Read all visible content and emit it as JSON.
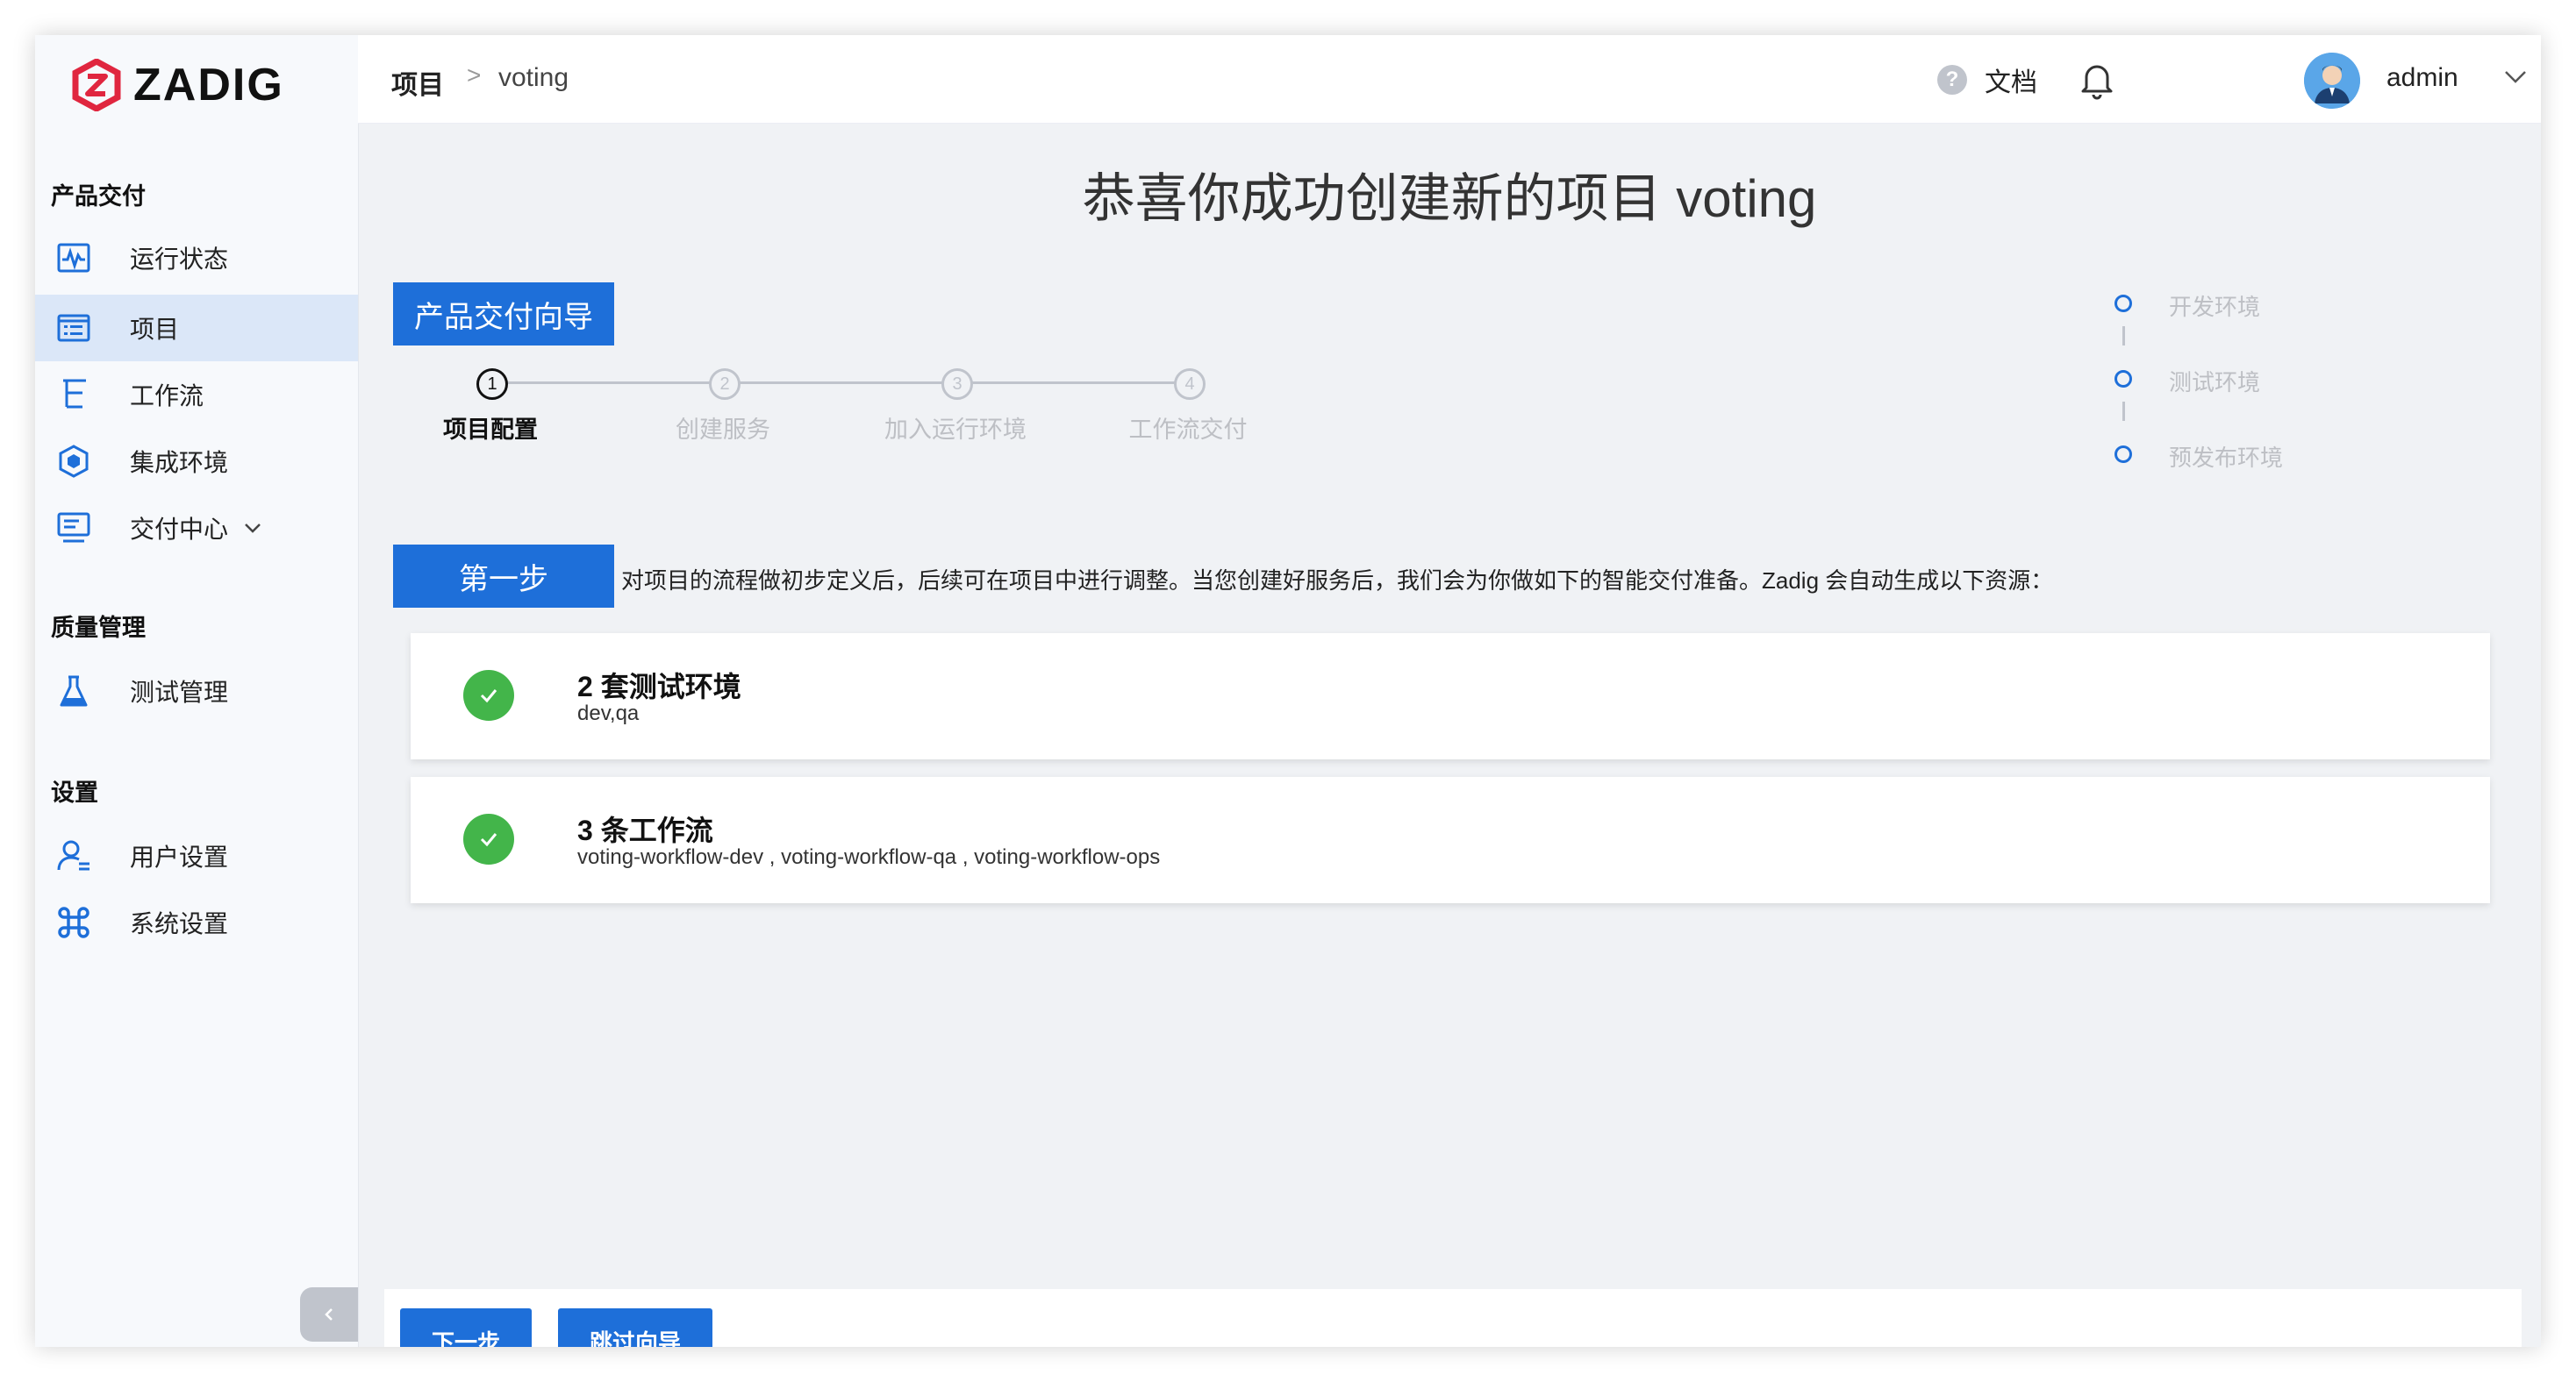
{
  "app": {
    "logo_text": "ZADIG",
    "brand_color": "#e0263f",
    "accent_color": "#1e6fd9",
    "success_color": "#43b54a"
  },
  "sidebar": {
    "sections": [
      {
        "title": "产品交付",
        "items": [
          {
            "label": "运行状态",
            "icon": "pulse-monitor-icon"
          },
          {
            "label": "项目",
            "icon": "project-list-icon",
            "active": true
          },
          {
            "label": "工作流",
            "icon": "workflow-tree-icon"
          },
          {
            "label": "集成环境",
            "icon": "cube-cluster-icon"
          },
          {
            "label": "交付中心",
            "icon": "delivery-screen-icon",
            "expandable": true
          }
        ]
      },
      {
        "title": "质量管理",
        "items": [
          {
            "label": "测试管理",
            "icon": "flask-icon"
          }
        ]
      },
      {
        "title": "设置",
        "items": [
          {
            "label": "用户设置",
            "icon": "user-settings-icon"
          },
          {
            "label": "系统设置",
            "icon": "command-icon"
          }
        ]
      }
    ],
    "collapse_glyph": "‹"
  },
  "header": {
    "breadcrumb_root": "项目",
    "breadcrumb_sep": ">",
    "breadcrumb_current": "voting",
    "help_glyph": "?",
    "doc_label": "文档",
    "username": "admin"
  },
  "main": {
    "title": "恭喜你成功创建新的项目 voting",
    "guide_tag": "产品交付向导",
    "steps": [
      {
        "num": "1",
        "label": "项目配置",
        "active": true
      },
      {
        "num": "2",
        "label": "创建服务",
        "active": false
      },
      {
        "num": "3",
        "label": "加入运行环境",
        "active": false
      },
      {
        "num": "4",
        "label": "工作流交付",
        "active": false
      }
    ],
    "envs": [
      "开发环境",
      "测试环境",
      "预发布环境"
    ],
    "step_tag": "第一步",
    "step_desc": "对项目的流程做初步定义后，后续可在项目中进行调整。当您创建好服务后，我们会为你做如下的智能交付准备。Zadig 会自动生成以下资源：",
    "cards": [
      {
        "title": "2 套测试环境",
        "subtitle": "dev,qa"
      },
      {
        "title": "3 条工作流",
        "subtitle": "voting-workflow-dev , voting-workflow-qa , voting-workflow-ops"
      }
    ],
    "next_button": "下一步",
    "skip_button": "跳过向导"
  }
}
